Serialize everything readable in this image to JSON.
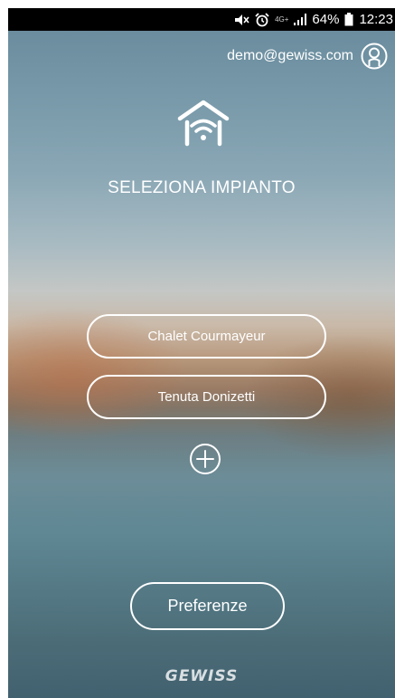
{
  "status_bar": {
    "network": "4G+",
    "battery": "64%",
    "time": "12:23",
    "icons": [
      "mute-icon",
      "alarm-icon",
      "network-icon",
      "signal-icon",
      "battery-icon"
    ]
  },
  "account": {
    "email": "demo@gewiss.com",
    "icon": "user-icon"
  },
  "header": {
    "icon": "home-wifi-icon",
    "title": "SELEZIONA IMPIANTO"
  },
  "plants": [
    {
      "label": "Chalet Courmayeur"
    },
    {
      "label": "Tenuta Donizetti"
    }
  ],
  "add_plant": {
    "icon": "plus-circle-icon"
  },
  "preferences": {
    "label": "Preferenze"
  },
  "brand": {
    "logo_text": "GEWISS"
  },
  "colors": {
    "foreground": "#ffffff",
    "status_bar": "#000000"
  }
}
